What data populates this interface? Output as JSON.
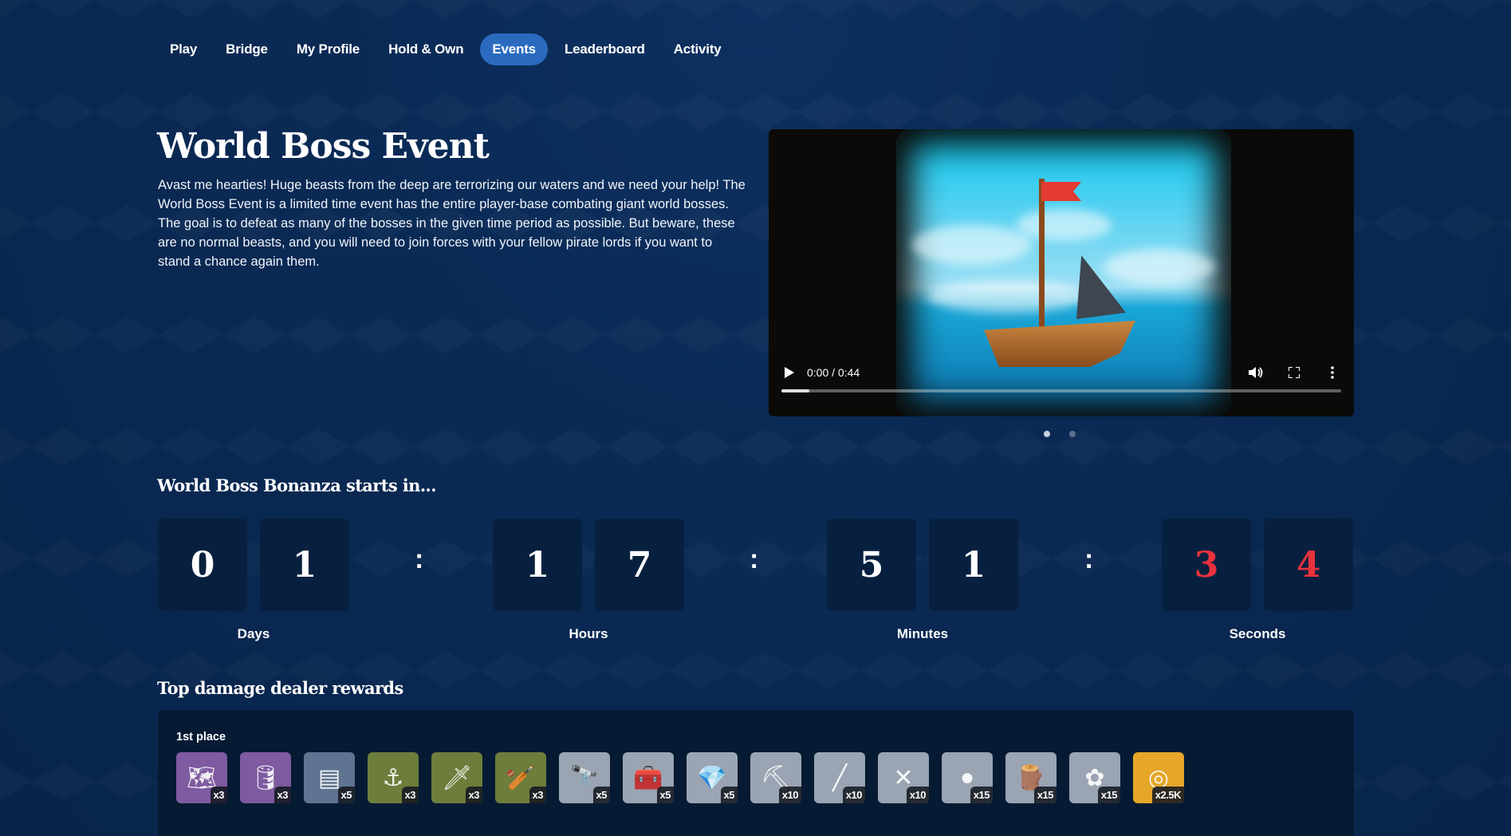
{
  "nav": {
    "items": [
      "Play",
      "Bridge",
      "My Profile",
      "Hold & Own",
      "Events",
      "Leaderboard",
      "Activity"
    ],
    "active": "Events"
  },
  "event": {
    "title": "World Boss Event",
    "description": "Avast me hearties! Huge beasts from the deep are terrorizing our waters and we need your help! The World Boss Event is a limited time event has the entire player-base combating giant world bosses. The goal is to defeat as many of the bosses in the given time period as possible. But beware, these are no normal beasts, and you will need to join forces with your fellow pirate lords if you want to stand a chance again them."
  },
  "video": {
    "time": "0:00 / 0:44",
    "progress": 0.05,
    "carousel_slides": 2,
    "carousel_active": 1
  },
  "countdown": {
    "title": "World Boss Bonanza starts in...",
    "days": [
      "0",
      "1"
    ],
    "hours": [
      "1",
      "7"
    ],
    "minutes": [
      "5",
      "1"
    ],
    "seconds": [
      "3",
      "4"
    ],
    "separator": ":",
    "labels": {
      "days": "Days",
      "hours": "Hours",
      "minutes": "Minutes",
      "seconds": "Seconds"
    }
  },
  "rewards": {
    "title": "Top damage dealer rewards",
    "place": "1st place",
    "items": [
      {
        "icon": "map-icon",
        "qty": "x3",
        "bg": "#7e5aa0"
      },
      {
        "icon": "barrel-icon",
        "qty": "x3",
        "bg": "#7e5aa0"
      },
      {
        "icon": "plank-icon",
        "qty": "x5",
        "bg": "#5e7490"
      },
      {
        "icon": "grapple-icon",
        "qty": "x3",
        "bg": "#6d7d3c"
      },
      {
        "icon": "sword-icon",
        "qty": "x3",
        "bg": "#6d7d3c"
      },
      {
        "icon": "club-icon",
        "qty": "x3",
        "bg": "#6d7d3c"
      },
      {
        "icon": "spyglass-icon",
        "qty": "x5",
        "bg": "#9aa4b2"
      },
      {
        "icon": "chest-icon",
        "qty": "x5",
        "bg": "#9aa4b2"
      },
      {
        "icon": "gem-icon",
        "qty": "x5",
        "bg": "#9aa4b2"
      },
      {
        "icon": "ore-icon",
        "qty": "x10",
        "bg": "#9aa4b2"
      },
      {
        "icon": "stick-icon",
        "qty": "x10",
        "bg": "#9aa4b2"
      },
      {
        "icon": "rope-icon",
        "qty": "x10",
        "bg": "#9aa4b2"
      },
      {
        "icon": "coal-icon",
        "qty": "x15",
        "bg": "#9aa4b2"
      },
      {
        "icon": "logs-icon",
        "qty": "x15",
        "bg": "#9aa4b2"
      },
      {
        "icon": "cotton-icon",
        "qty": "x15",
        "bg": "#9aa4b2"
      },
      {
        "icon": "gold-coin-icon",
        "qty": "x2.5K",
        "bg": "#e6a62a"
      }
    ]
  },
  "colors": {
    "accent": "#2a6bc0",
    "seconds": "#e8323c"
  }
}
